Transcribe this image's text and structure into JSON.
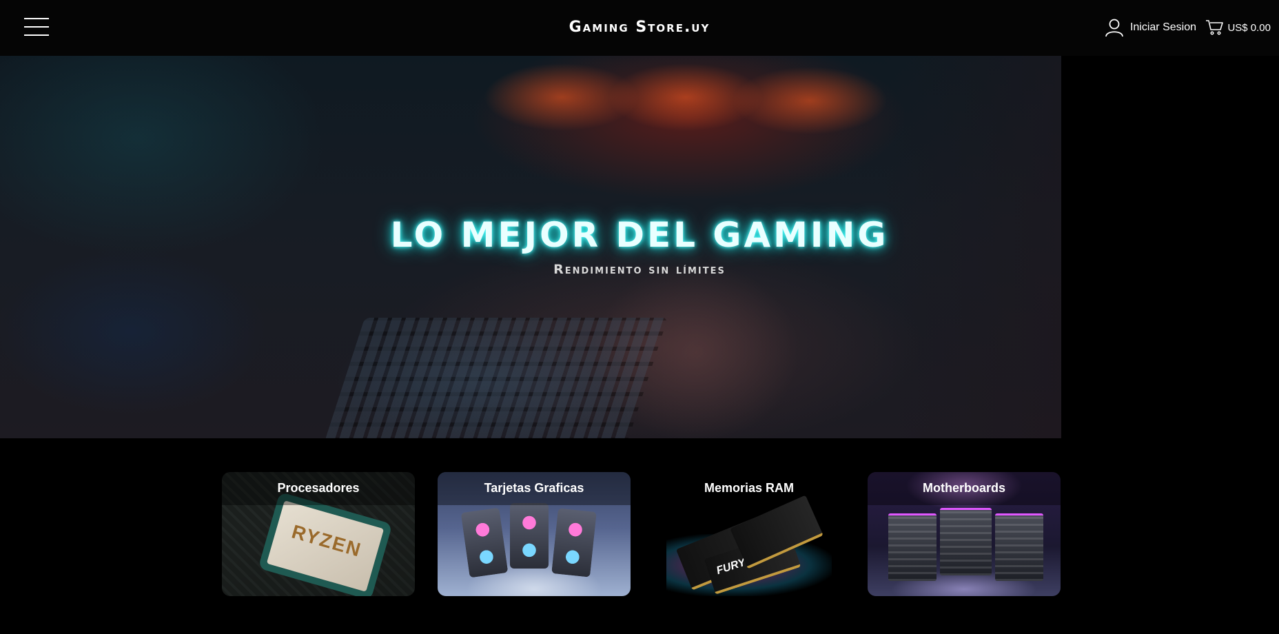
{
  "header": {
    "brand": "Gaming Store.uy",
    "login_label": "Iniciar Sesion",
    "cart_total": "US$ 0.00",
    "icons": {
      "menu": "hamburger-menu-icon",
      "user": "user-icon",
      "cart": "cart-icon"
    }
  },
  "hero": {
    "title": "LO MEJOR DEL GAMING",
    "subtitle": "Rendimiento sin límites"
  },
  "categories": [
    {
      "label": "Procesadores",
      "image_text": "RYZEN"
    },
    {
      "label": "Tarjetas Graficas"
    },
    {
      "label": "Memorias RAM",
      "image_text": "FURY"
    },
    {
      "label": "Motherboards"
    }
  ],
  "colors": {
    "background": "#000000",
    "header_bg": "#050505",
    "hero_glow": "#22dddd",
    "text": "#ffffff"
  }
}
